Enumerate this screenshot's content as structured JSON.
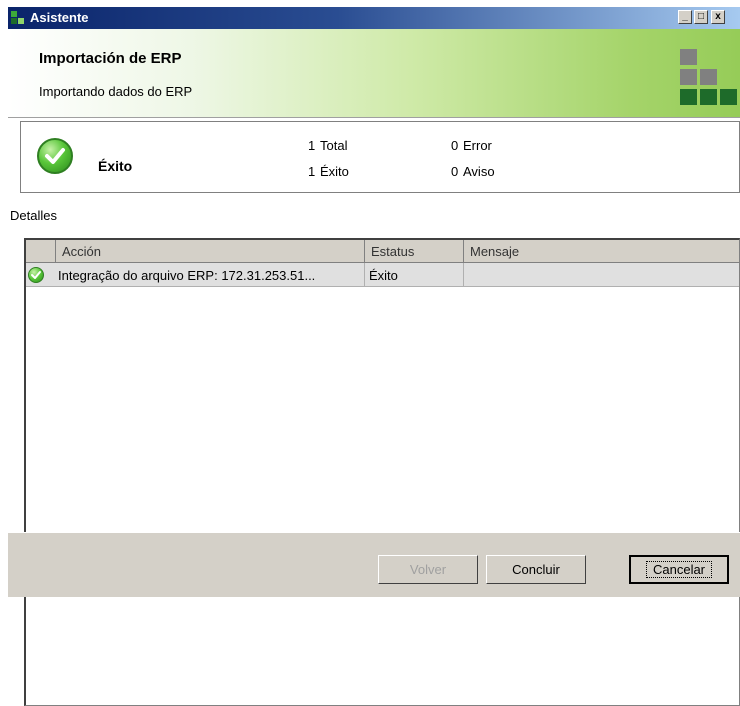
{
  "window": {
    "title": "Asistente"
  },
  "banner": {
    "title": "Importación de ERP",
    "subtitle": "Importando dados do ERP"
  },
  "summary": {
    "status": "Éxito",
    "stats": [
      {
        "count": "1",
        "label": "Total"
      },
      {
        "count": "1",
        "label": "Éxito"
      },
      {
        "count": "0",
        "label": "Error"
      },
      {
        "count": "0",
        "label": "Aviso"
      }
    ]
  },
  "details": {
    "label": "Detalles",
    "columns": [
      "Acción",
      "Estatus",
      "Mensaje"
    ],
    "rows": [
      {
        "icon": "success-check-icon",
        "accion": "Integração do arquivo ERP: 172.31.253.51...",
        "estatus": "Éxito",
        "mensaje": ""
      }
    ]
  },
  "buttons": {
    "back": "Volver",
    "finish": "Concluir",
    "cancel": "Cancelar"
  },
  "colors": {
    "titlebar": "#0a246a",
    "banner_accent": "#96cc58",
    "success_green": "#59c63a",
    "logo_gray": "#808080",
    "logo_green": "#1e6b2a"
  }
}
